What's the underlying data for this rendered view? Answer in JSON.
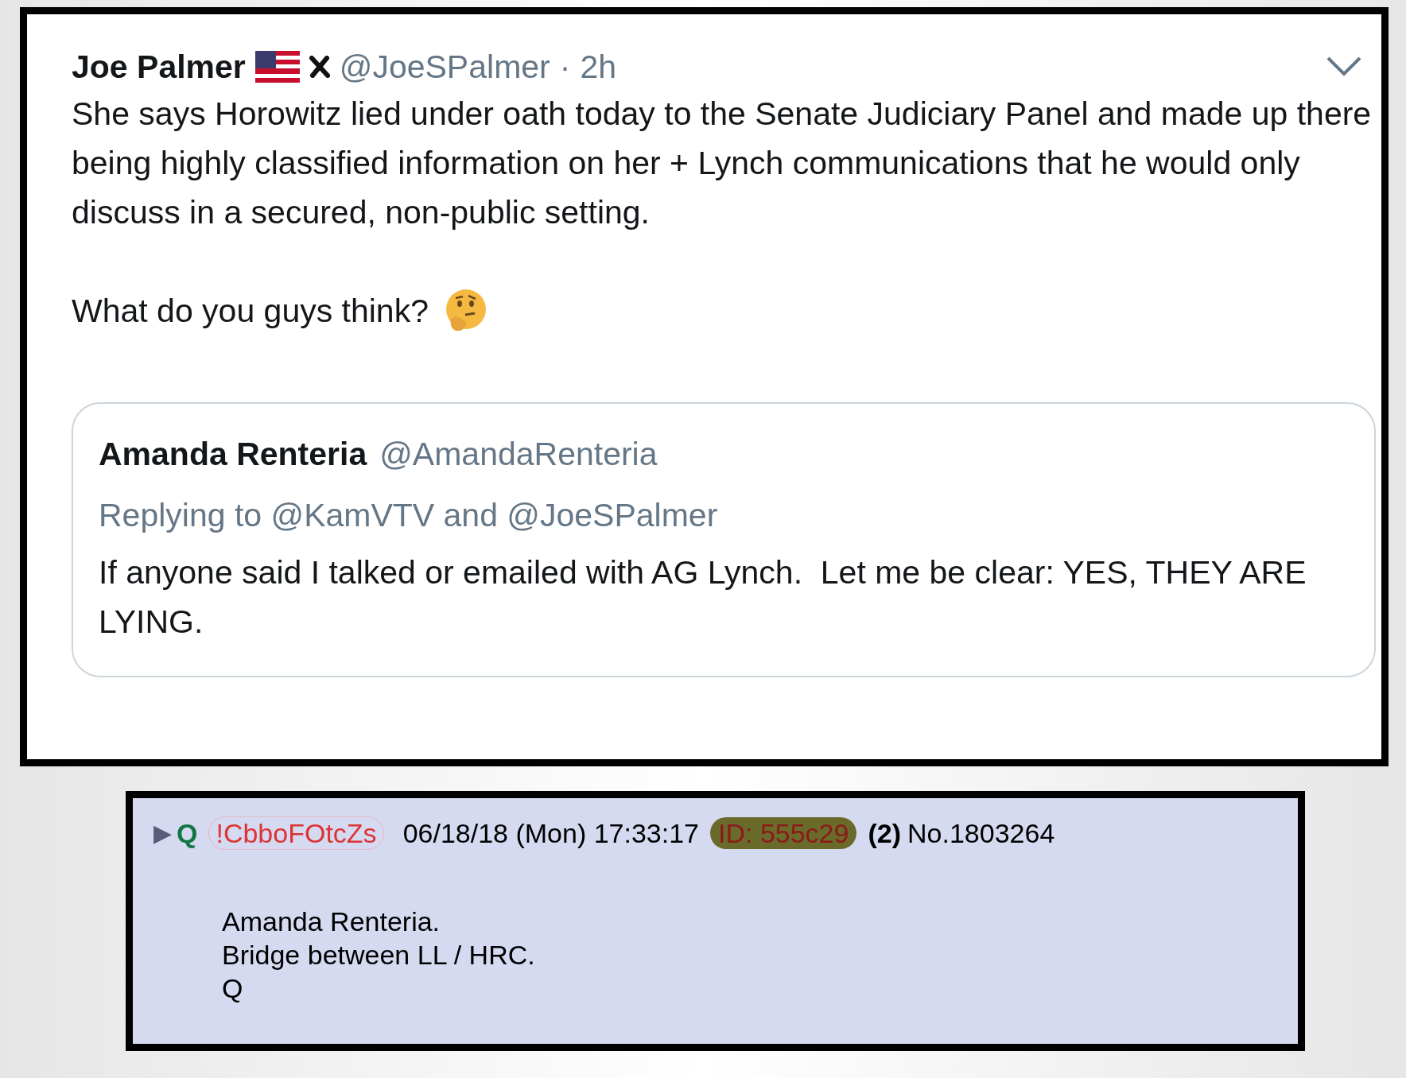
{
  "tweet": {
    "name": "Joe Palmer",
    "handle": "@JoeSPalmer",
    "separator": "·",
    "time": "2h",
    "paragraphs": [
      "She says Horowitz lied under oath today to the Senate Judiciary Panel and made up there being highly classified information on her + Lynch communications that he would only discuss in a secured, non-public setting.",
      "What do you guys think?"
    ],
    "quoted": {
      "name": "Amanda Renteria",
      "handle": "@AmandaRenteria",
      "replying": "Replying to @KamVTV and @JoeSPalmer",
      "text": "If anyone said I talked or emailed with AG Lynch.  Let me be clear: YES, THEY ARE LYING."
    }
  },
  "post": {
    "arrow": "▶",
    "name": "Q",
    "tripcode": "!CbboFOtcZs",
    "datetime": "06/18/18 (Mon) 17:33:17",
    "id": "ID: 555c29",
    "count": "(2)",
    "number": "No.1803264",
    "lines": [
      "Amanda Renteria.",
      "Bridge between LL / HRC.",
      "Q"
    ]
  }
}
